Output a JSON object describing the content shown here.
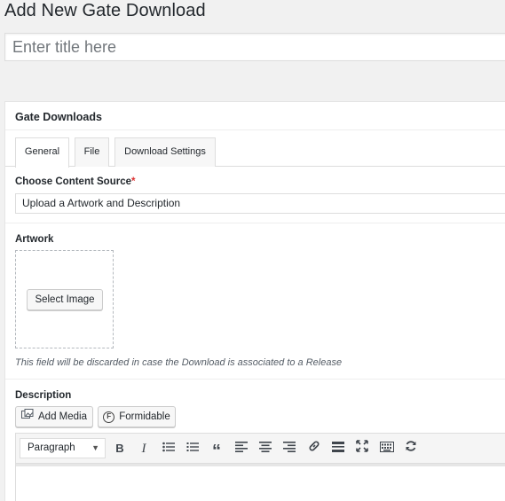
{
  "page": {
    "title": "Add New Gate Download"
  },
  "title_field": {
    "placeholder": "Enter title here",
    "value": ""
  },
  "metabox": {
    "title": "Gate Downloads",
    "tabs": [
      {
        "label": "General",
        "active": true
      },
      {
        "label": "File",
        "active": false
      },
      {
        "label": "Download Settings",
        "active": false
      }
    ],
    "content_source": {
      "label": "Choose Content Source",
      "required_mark": "*",
      "value": "Upload a Artwork and Description"
    },
    "artwork": {
      "label": "Artwork",
      "button_label": "Select Image",
      "hint": "This field will be discarded in case the Download is associated to a Release"
    },
    "description": {
      "label": "Description",
      "add_media_label": "Add Media",
      "formidable_label": "Formidable",
      "format_value": "Paragraph",
      "toolbar_icons": [
        "bold-icon",
        "italic-icon",
        "bullet-list-icon",
        "numbered-list-icon",
        "blockquote-icon",
        "align-left-icon",
        "align-center-icon",
        "align-right-icon",
        "link-icon",
        "read-more-icon",
        "fullscreen-icon",
        "toolbar-toggle-icon",
        "refresh-icon"
      ]
    }
  },
  "colors": {
    "background": "#f1f1f1",
    "required": "#dc3232",
    "border": "#dddddd"
  }
}
